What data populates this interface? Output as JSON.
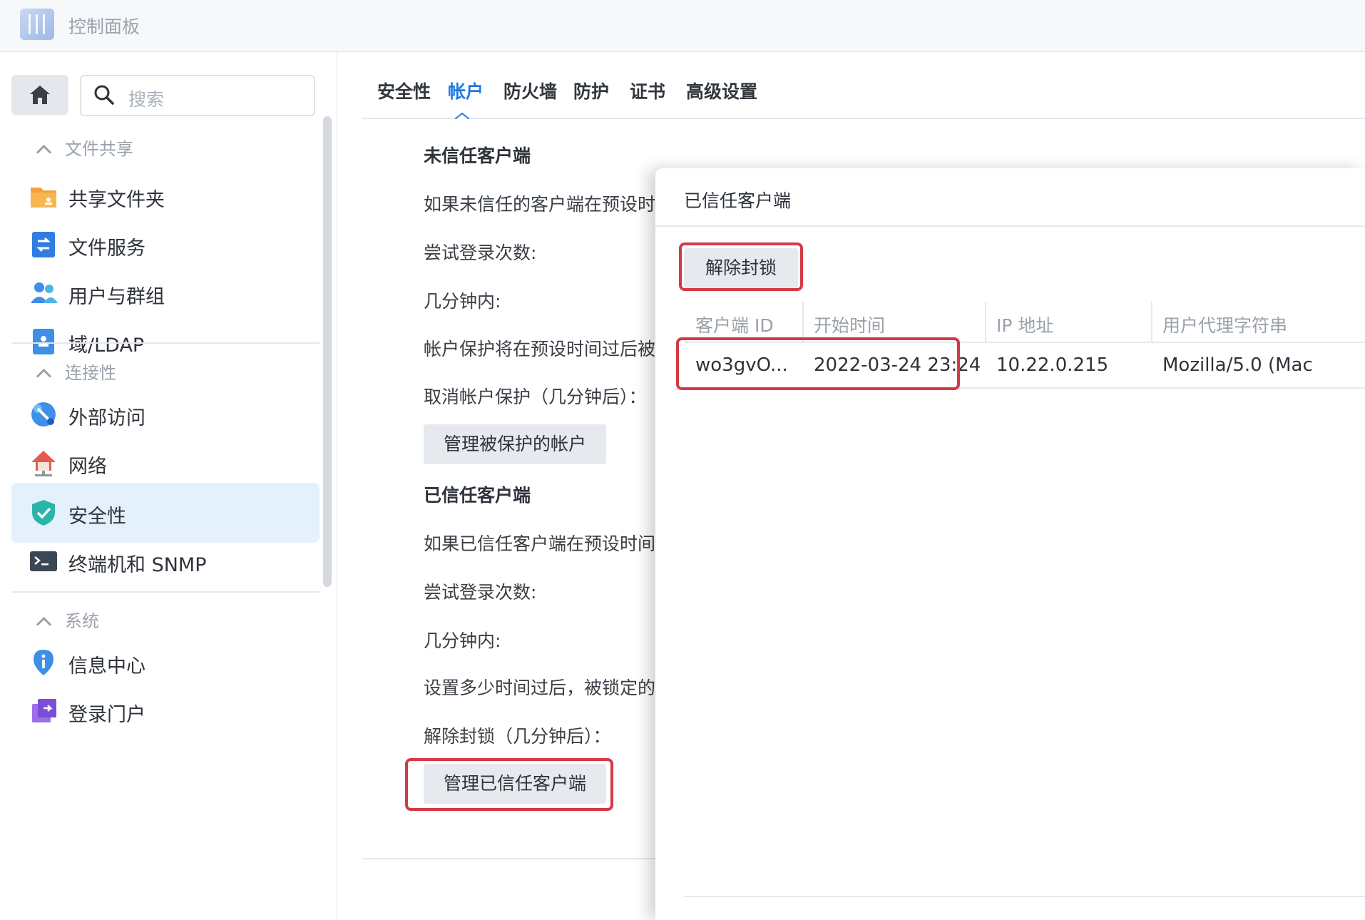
{
  "window": {
    "title": "控制面板"
  },
  "sidebar": {
    "search_placeholder": "搜索",
    "groups": [
      {
        "label": "文件共享"
      },
      {
        "label": "连接性"
      },
      {
        "label": "系统"
      }
    ],
    "items": [
      {
        "label": "共享文件夹",
        "icon": "folder-share-icon"
      },
      {
        "label": "文件服务",
        "icon": "file-services-icon"
      },
      {
        "label": "用户与群组",
        "icon": "users-icon"
      },
      {
        "label": "域/LDAP",
        "icon": "domain-ldap-icon"
      },
      {
        "label": "外部访问",
        "icon": "external-access-icon"
      },
      {
        "label": "网络",
        "icon": "network-icon"
      },
      {
        "label": "安全性",
        "icon": "security-shield-icon",
        "active": true
      },
      {
        "label": "终端机和 SNMP",
        "icon": "terminal-icon"
      },
      {
        "label": "信息中心",
        "icon": "info-center-icon"
      },
      {
        "label": "登录门户",
        "icon": "login-portal-icon"
      }
    ]
  },
  "tabs": [
    {
      "label": "安全性"
    },
    {
      "label": "帐户",
      "active": true
    },
    {
      "label": "防火墙"
    },
    {
      "label": "防护"
    },
    {
      "label": "证书"
    },
    {
      "label": "高级设置"
    }
  ],
  "content": {
    "untrusted": {
      "title": "未信任客户端",
      "rows": [
        "如果未信任的客户端在预设时",
        "尝试登录次数:",
        "几分钟内:",
        "帐户保护将在预设时间过后被",
        "取消帐户保护（几分钟后）："
      ],
      "button": "管理被保护的帐户"
    },
    "trusted": {
      "title": "已信任客户端",
      "rows": [
        "如果已信任客户端在预设时间",
        "尝试登录次数:",
        "几分钟内:",
        "设置多少时间过后，被锁定的",
        "解除封锁（几分钟后）："
      ],
      "button": "管理已信任客户端"
    }
  },
  "dialog": {
    "title": "已信任客户端",
    "unblock_button": "解除封锁",
    "columns": [
      "客户端 ID",
      "开始时间",
      "IP 地址",
      "用户代理字符串"
    ],
    "rows": [
      {
        "client_id": "wo3gvO...",
        "start_time": "2022-03-24 23:24",
        "ip": "10.22.0.215",
        "user_agent": "Mozilla/5.0 (Mac"
      }
    ]
  },
  "colors": {
    "accent": "#1f7ae0",
    "highlight": "#d33a46",
    "active_bg": "#e4f1fc"
  }
}
